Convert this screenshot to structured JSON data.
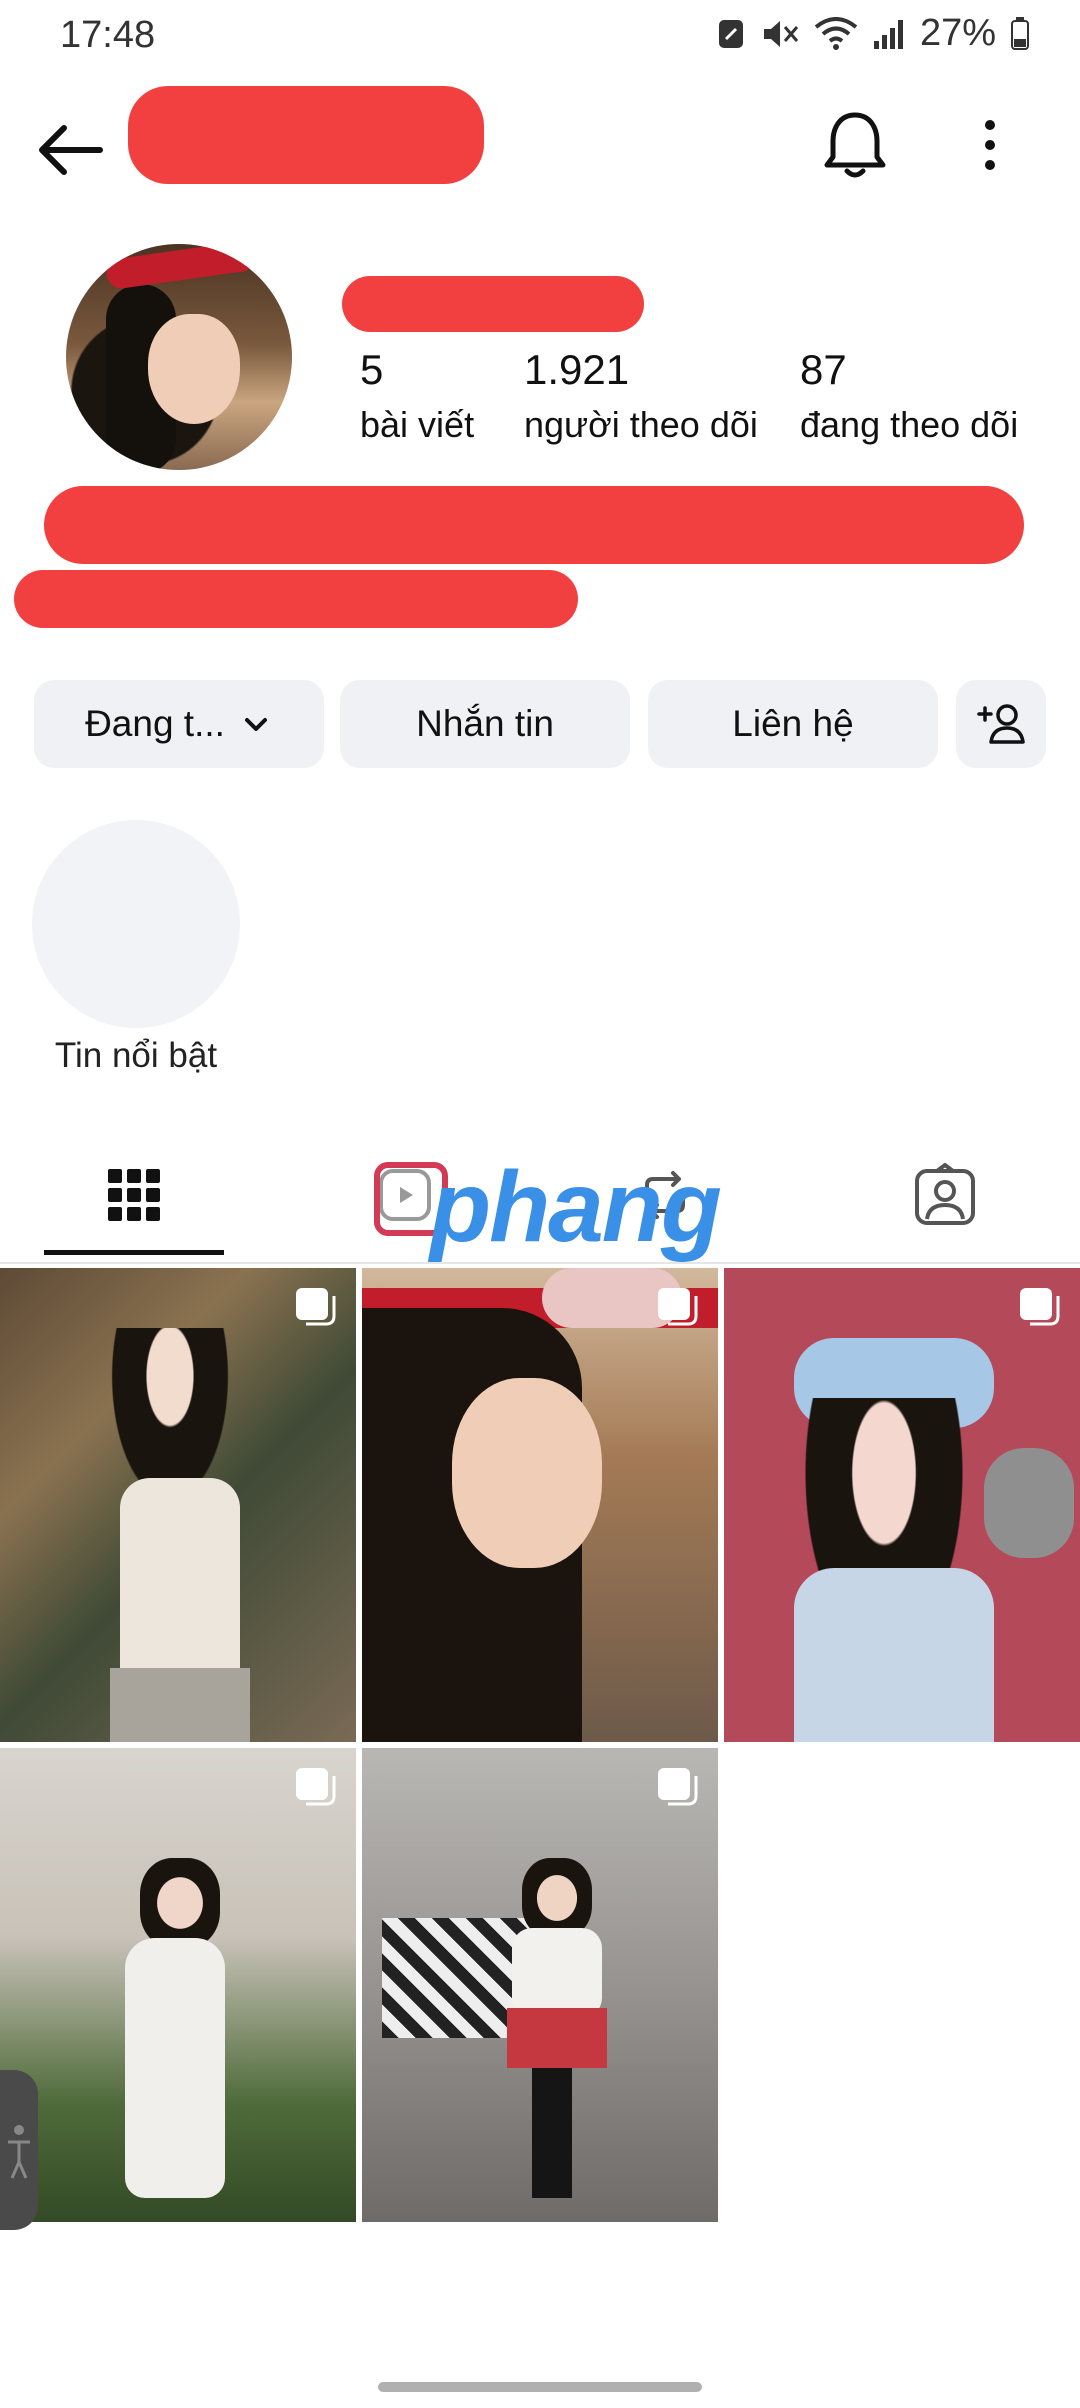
{
  "status_bar": {
    "time": "17:48",
    "battery": "27%",
    "icons": [
      "data-saver-icon",
      "mute-icon",
      "wifi-icon",
      "signal-icon",
      "battery-icon"
    ]
  },
  "header": {
    "back_icon": "arrow-left-icon",
    "bell_icon": "bell-icon",
    "more_icon": "more-vertical-icon"
  },
  "profile": {
    "stats": [
      {
        "value": "5",
        "label": "bài viết"
      },
      {
        "value": "1.921",
        "label": "người theo dõi"
      },
      {
        "value": "87",
        "label": "đang theo dõi"
      }
    ]
  },
  "actions": {
    "following": "Đang t...",
    "message": "Nhắn tin",
    "contact": "Liên hệ",
    "add_person_icon": "add-person-icon"
  },
  "highlights": {
    "label": "Tin nổi bật"
  },
  "tabs": {
    "items": [
      "grid-icon",
      "reels-icon",
      "repost-icon",
      "tagged-icon"
    ],
    "active": "grid-icon"
  },
  "watermark": {
    "text": "phang"
  },
  "colors": {
    "redaction": "#f24040",
    "button_bg": "#eff1f4",
    "text": "#111111"
  },
  "posts": {
    "count": 5,
    "multi_icon": "carousel-icon"
  }
}
